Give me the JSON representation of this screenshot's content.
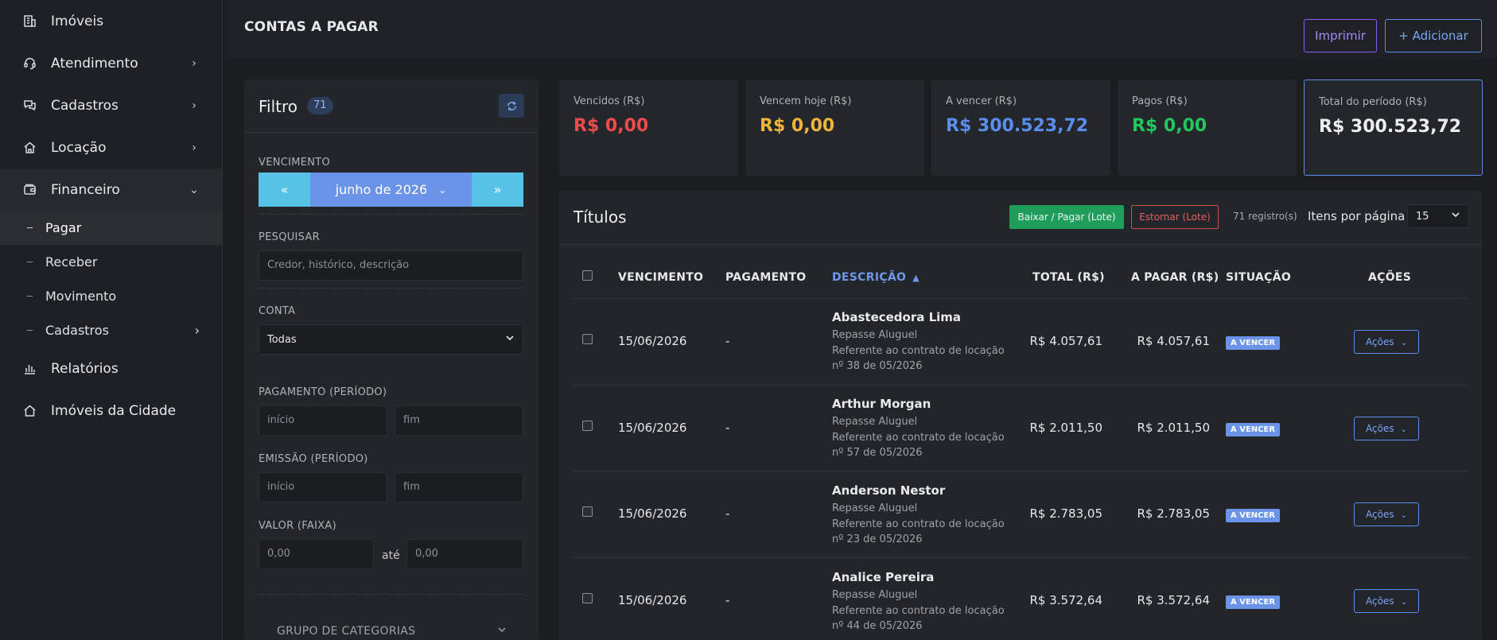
{
  "sidebar": {
    "items": [
      {
        "label": "Imóveis",
        "icon": "building-icon",
        "chevron": ""
      },
      {
        "label": "Atendimento",
        "icon": "headset-icon",
        "chevron": "›"
      },
      {
        "label": "Cadastros",
        "icon": "chat-icon",
        "chevron": "›"
      },
      {
        "label": "Locação",
        "icon": "home-icon",
        "chevron": "›"
      },
      {
        "label": "Financeiro",
        "icon": "wallet-icon",
        "chevron": "⌄"
      }
    ],
    "subitems": [
      {
        "label": "Pagar",
        "chevron": ""
      },
      {
        "label": "Receber",
        "chevron": ""
      },
      {
        "label": "Movimento",
        "chevron": ""
      },
      {
        "label": "Cadastros",
        "chevron": "›"
      }
    ],
    "bottom_items": [
      {
        "label": "Relatórios",
        "icon": "bar-chart-icon"
      },
      {
        "label": "Imóveis da Cidade",
        "icon": "home-outline-icon"
      }
    ]
  },
  "header": {
    "title": "CONTAS A PAGAR",
    "print_label": "Imprimir",
    "add_label": "+ Adicionar"
  },
  "filter": {
    "title": "Filtro",
    "count": "71",
    "vencimento_label": "VENCIMENTO",
    "prev": "«",
    "month": "junho de 2026",
    "next": "»",
    "pesquisar_label": "PESQUISAR",
    "search_placeholder": "Credor, histórico, descrição",
    "conta_label": "CONTA",
    "conta_value": "Todas",
    "pagamento_label": "PAGAMENTO (PERÍODO)",
    "inicio_placeholder": "início",
    "fim_placeholder": "fim",
    "emissao_label": "EMISSÃO (PERÍODO)",
    "valor_label": "VALOR (FAIXA)",
    "valor_min_placeholder": "0,00",
    "ate": "até",
    "valor_max_placeholder": "0,00",
    "grupo_label": "GRUPO DE CATEGORIAS"
  },
  "cards": [
    {
      "label": "Vencidos (R$)",
      "value": "R$ 0,00",
      "color": "#ef4b4b"
    },
    {
      "label": "Vencem hoje (R$)",
      "value": "R$ 0,00",
      "color": "#f0b43c"
    },
    {
      "label": "A vencer (R$)",
      "value": "R$ 300.523,72",
      "color": "#5b8def"
    },
    {
      "label": "Pagos (R$)",
      "value": "R$ 0,00",
      "color": "#22c55e"
    },
    {
      "label": "Total do período (R$)",
      "value": "R$ 300.523,72",
      "color": "#eceef2"
    }
  ],
  "table": {
    "title": "Títulos",
    "baixar_label": "Baixar / Pagar (Lote)",
    "estornar_label": "Estornar (Lote)",
    "registros": "71 registro(s)",
    "itens_label": "Itens por página",
    "itens_value": "15",
    "columns": [
      "VENCIMENTO",
      "PAGAMENTO",
      "DESCRIÇÃO",
      "TOTAL (R$)",
      "A PAGAR (R$)",
      "SITUAÇÃO",
      "AÇÕES"
    ],
    "rows": [
      {
        "vencimento": "15/06/2026",
        "pagamento": "-",
        "credor": "Abastecedora Lima",
        "historico": "Repasse Aluguel",
        "desc1": "Referente ao contrato de locação",
        "desc2": "nº 38 de 05/2026",
        "total": "R$ 4.057,61",
        "a_pagar": "R$ 4.057,61",
        "situacao": "A VENCER",
        "acoes": "Ações"
      },
      {
        "vencimento": "15/06/2026",
        "pagamento": "-",
        "credor": "Arthur Morgan",
        "historico": "Repasse Aluguel",
        "desc1": "Referente ao contrato de locação",
        "desc2": "nº 57 de 05/2026",
        "total": "R$ 2.011,50",
        "a_pagar": "R$ 2.011,50",
        "situacao": "A VENCER",
        "acoes": "Ações"
      },
      {
        "vencimento": "15/06/2026",
        "pagamento": "-",
        "credor": "Anderson Nestor",
        "historico": "Repasse Aluguel",
        "desc1": "Referente ao contrato de locação",
        "desc2": "nº 23 de 05/2026",
        "total": "R$ 2.783,05",
        "a_pagar": "R$ 2.783,05",
        "situacao": "A VENCER",
        "acoes": "Ações"
      },
      {
        "vencimento": "15/06/2026",
        "pagamento": "-",
        "credor": "Analice Pereira",
        "historico": "Repasse Aluguel",
        "desc1": "Referente ao contrato de locação",
        "desc2": "nº 44 de 05/2026",
        "total": "R$ 3.572,64",
        "a_pagar": "R$ 3.572,64",
        "situacao": "A VENCER",
        "acoes": "Ações"
      }
    ]
  }
}
